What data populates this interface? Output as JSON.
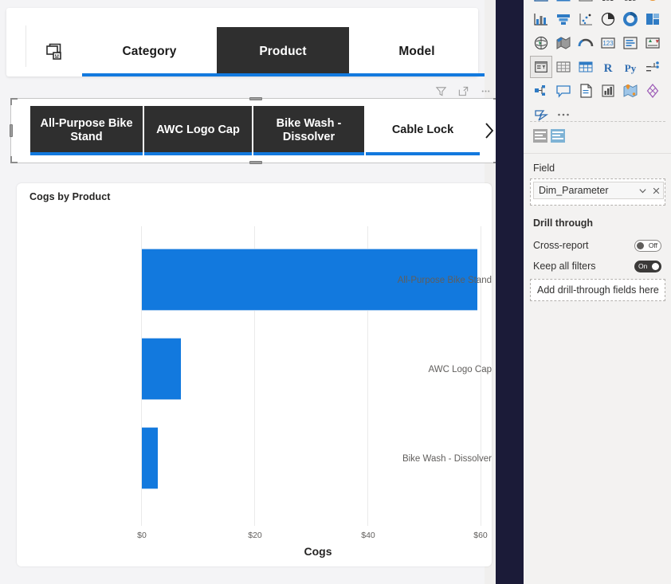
{
  "page_navigator": {
    "icon": "page-navigator-icon",
    "tabs": [
      {
        "label": "Category",
        "state": "inactive"
      },
      {
        "label": "Product",
        "state": "active"
      },
      {
        "label": "Model",
        "state": "inactive"
      }
    ],
    "accent_color": "#1279de",
    "active_bg": "#2f2f2f"
  },
  "visual_header": {
    "filter_icon": "filter-icon",
    "focus_icon": "focus-mode-icon",
    "more_icon": "more-options-icon"
  },
  "slicer": {
    "tiles": [
      {
        "label": "All-Purpose Bike Stand",
        "selected": false
      },
      {
        "label": "AWC Logo Cap",
        "selected": false
      },
      {
        "label": "Bike Wash - Dissolver",
        "selected": false
      },
      {
        "label": "Cable Lock",
        "selected": true
      }
    ],
    "next_icon": "chevron-right-icon"
  },
  "chart_data": {
    "type": "bar",
    "orientation": "horizontal",
    "title": "Cogs by Product",
    "categories": [
      "All-Purpose Bike Stand",
      "AWC Logo Cap",
      "Bike Wash - Dissolver"
    ],
    "values": [
      59.3,
      6.9,
      2.8
    ],
    "xlabel": "Cogs",
    "ylabel": "",
    "xlim": [
      0,
      60
    ],
    "x_ticks": [
      "$0",
      "$20",
      "$40",
      "$60"
    ],
    "x_tick_values": [
      0,
      20,
      40,
      60
    ],
    "grid": true,
    "legend": "none",
    "series_color": "#1279de"
  },
  "right_pane": {
    "gallery": {
      "rows": [
        [
          "area-chart-icon",
          "filled-map-icon",
          "line-area-icon",
          "stacked-column-icon",
          "clustered-column-icon",
          "pie-donut-icon"
        ],
        [
          "column-chart-icon",
          "funnel-chart-icon",
          "scatter-chart-icon",
          "pie-chart-icon",
          "donut-chart-icon",
          "treemap-icon"
        ],
        [
          "map-icon",
          "filled-map-shape-icon",
          "arc-gauge-icon",
          "card-number-icon",
          "multi-row-card-icon",
          "kpi-icon"
        ],
        [
          "slicer-icon",
          "table-icon",
          "matrix-icon",
          "r-script-visual-icon",
          "python-visual-icon",
          "decomposition-tree-icon"
        ],
        [
          "key-influencers-icon",
          "smart-narrative-icon",
          "paginated-report-icon",
          "power-apps-icon",
          "arcgis-maps-icon",
          "azure-map-icon"
        ],
        [
          "power-automate-icon",
          "more-visuals-icon"
        ]
      ],
      "selected_icon": "slicer-icon"
    },
    "format_tabs": [
      "build-visual-icon",
      "format-visual-icon"
    ],
    "field_section": {
      "label": "Field",
      "chip": {
        "name": "Dim_Parameter",
        "dropdown_icon": "chevron-down-icon",
        "remove_icon": "close-icon"
      }
    },
    "drill_through": {
      "heading": "Drill through",
      "settings": [
        {
          "label": "Cross-report",
          "state": "Off",
          "on": false
        },
        {
          "label": "Keep all filters",
          "state": "On",
          "on": true
        }
      ],
      "dropzone_placeholder": "Add drill-through fields here"
    }
  }
}
